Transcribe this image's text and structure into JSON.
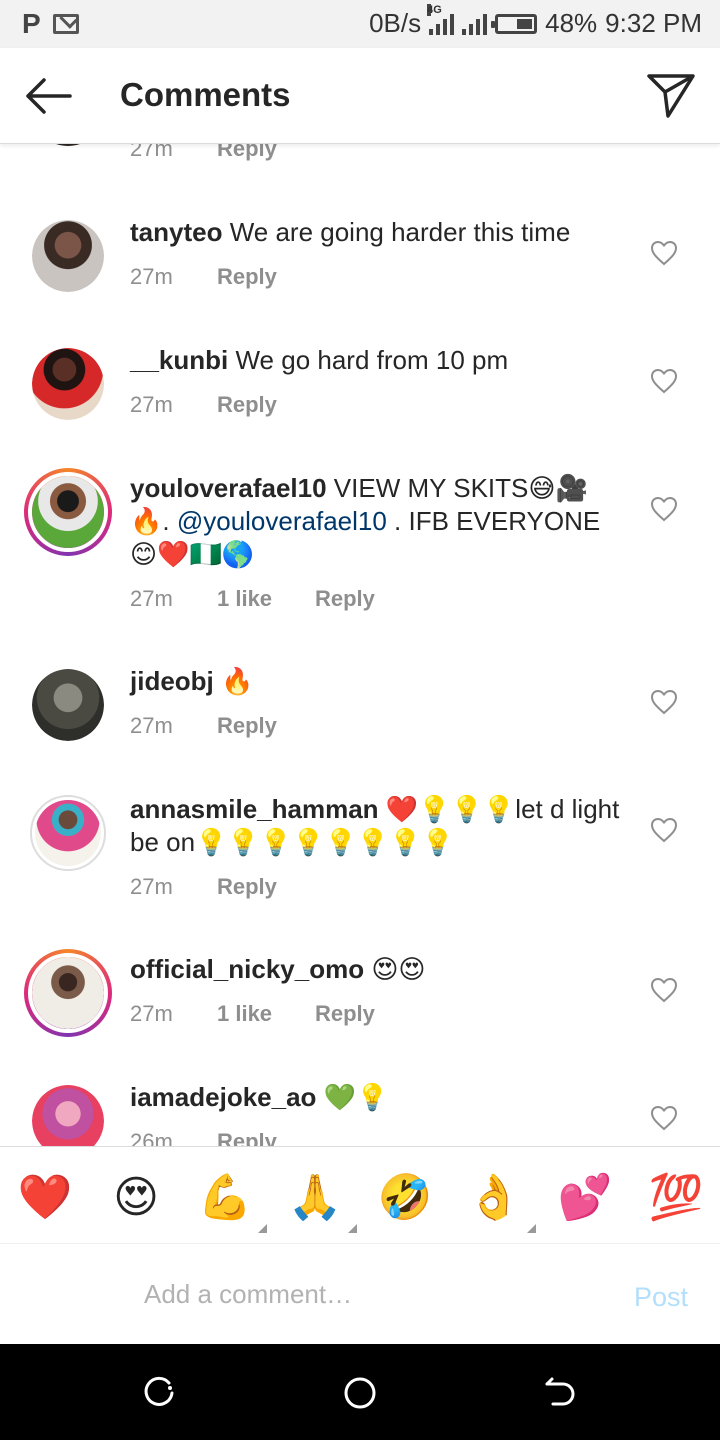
{
  "status_bar": {
    "network_speed": "0B/s",
    "network_type": "4G",
    "battery": "48%",
    "time": "9:32 PM"
  },
  "header": {
    "title": "Comments"
  },
  "comments": [
    {
      "username": "",
      "text": "",
      "time": "27m",
      "likes": "",
      "reply": "Reply"
    },
    {
      "username": "tanyteo",
      "text": "We are going harder this time",
      "time": "27m",
      "likes": "",
      "reply": "Reply"
    },
    {
      "username": "__kunbi",
      "text": "We go hard from 10 pm",
      "time": "27m",
      "likes": "",
      "reply": "Reply"
    },
    {
      "username": "youloverafael10",
      "text_1": "VIEW MY SKITS😅🎥",
      "text_2": "🔥.",
      "mention": "@youloverafael10",
      "text_3": ".  IFB EVERYONE",
      "text_4": "😊❤️🇳🇬🌎",
      "time": "27m",
      "likes": "1 like",
      "reply": "Reply"
    },
    {
      "username": "jideobj",
      "text": "🔥",
      "time": "27m",
      "likes": "",
      "reply": "Reply"
    },
    {
      "username": "annasmile_hamman",
      "text": "❤️💡💡💡let d light be on💡💡💡💡💡💡💡💡",
      "time": "27m",
      "likes": "",
      "reply": "Reply"
    },
    {
      "username": "official_nicky_omo",
      "text": "😍😍",
      "time": "27m",
      "likes": "1 like",
      "reply": "Reply"
    },
    {
      "username": "iamadejoke_ao",
      "text": "💚💡",
      "time": "26m",
      "likes": "",
      "reply": "Reply"
    }
  ],
  "emoji_bar": [
    "❤️",
    "😍",
    "💪",
    "🙏",
    "🤣",
    "👌",
    "💕",
    "💯"
  ],
  "input": {
    "placeholder": "Add a comment…",
    "post_label": "Post"
  },
  "colors": {
    "accent_link": "#00376b",
    "post_disabled": "#b2dffc",
    "meta_gray": "#8e8e8e"
  }
}
